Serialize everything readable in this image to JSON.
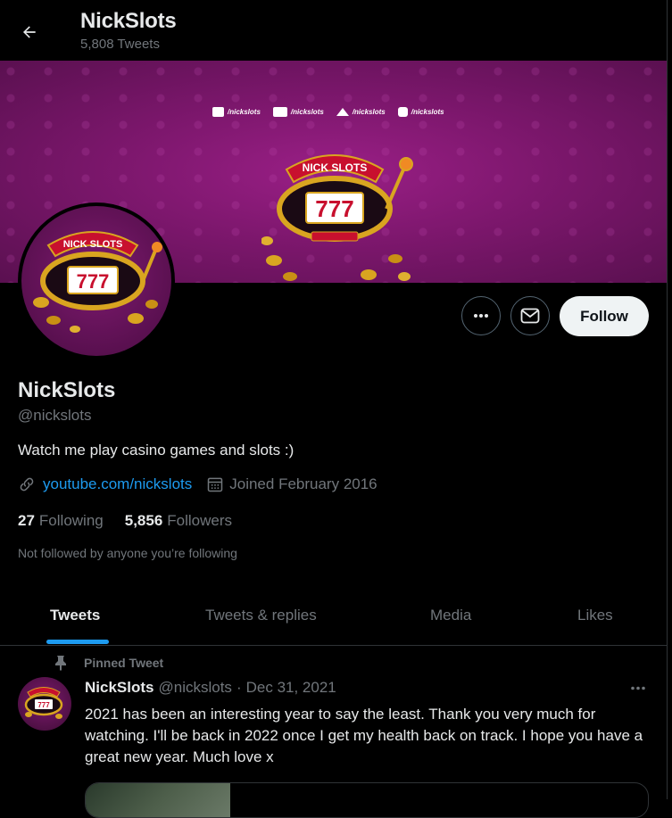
{
  "header": {
    "title": "NickSlots",
    "tweet_count": "5,808 Tweets"
  },
  "banner": {
    "socials": [
      {
        "icon": "twitch-icon",
        "label": "/nickslots"
      },
      {
        "icon": "youtube-icon",
        "label": "/nickslots"
      },
      {
        "icon": "twitter-icon",
        "label": "/nickslots"
      },
      {
        "icon": "instagram-icon",
        "label": "/nickslots"
      }
    ],
    "logo_text": "NICK SLOTS",
    "logo_digits": "777",
    "colors": {
      "purple": "#7d176d",
      "gold": "#d9a520",
      "red": "#c8102e"
    }
  },
  "actions": {
    "follow_label": "Follow"
  },
  "profile": {
    "display_name": "NickSlots",
    "handle": "@nickslots",
    "bio": "Watch me play casino games and slots :)",
    "link": "youtube.com/nickslots",
    "joined": "Joined February 2016",
    "following_count": "27",
    "following_label": "Following",
    "followers_count": "5,856",
    "followers_label": "Followers",
    "not_followed": "Not followed by anyone you’re following"
  },
  "tabs": [
    {
      "label": "Tweets",
      "active": true
    },
    {
      "label": "Tweets & replies",
      "active": false
    },
    {
      "label": "Media",
      "active": false
    },
    {
      "label": "Likes",
      "active": false
    }
  ],
  "tweet": {
    "pinned_label": "Pinned Tweet",
    "name": "NickSlots",
    "handle": "@nickslots",
    "separator": "·",
    "date": "Dec 31, 2021",
    "text": "2021 has been an interesting year to say the least. Thank you very much for watching. I'll be back in 2022 once I get my health back on track. I hope you have a great new year. Much love x"
  },
  "theme": {
    "accent": "#1d9bf0",
    "text": "#e7e9ea",
    "muted": "#71767b",
    "background": "#000000"
  }
}
